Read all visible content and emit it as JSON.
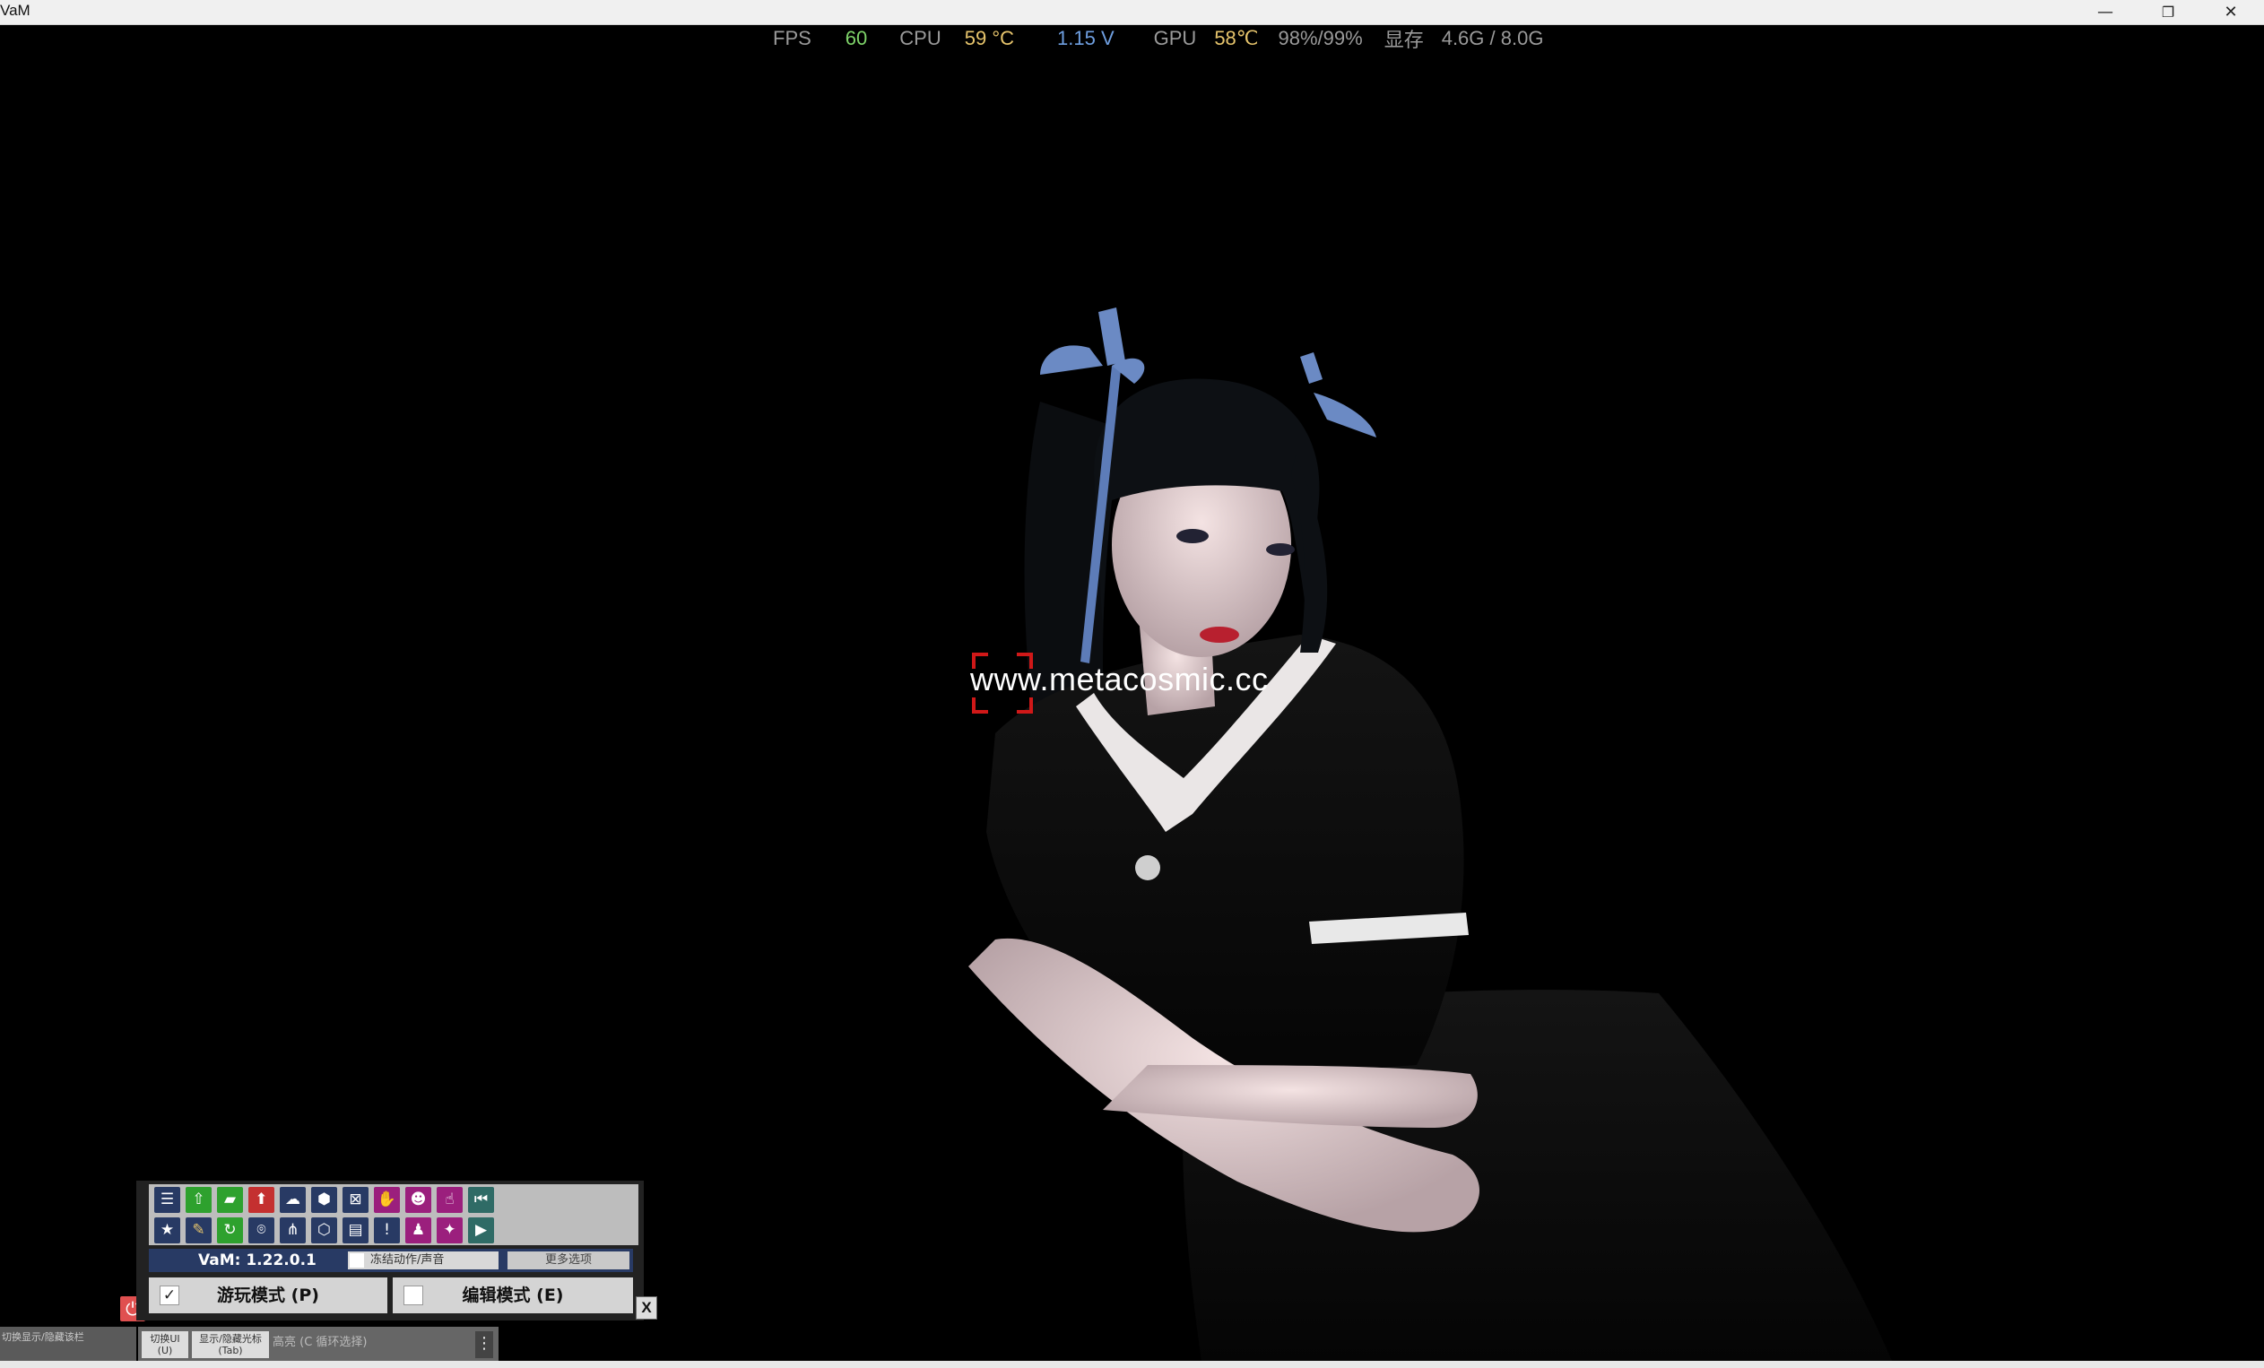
{
  "window": {
    "title": "VaM",
    "controls": {
      "minimize": "—",
      "restore": "❐",
      "close": "✕"
    }
  },
  "overlay": {
    "fps_label": "FPS",
    "fps_value": "60",
    "cpu_label": "CPU",
    "cpu_temp": "59 °C",
    "cpu_voltage": "1.15 V",
    "gpu_label": "GPU",
    "gpu_temp": "58℃",
    "gpu_usage": "98%/99%",
    "vram_label": "显存",
    "vram_value": "4.6G / 8.0G",
    "colors": {
      "label": "#9a9a9a",
      "fps": "#7fd46a",
      "temp": "#e6c46c",
      "voltage": "#6f9fe0"
    }
  },
  "scene": {
    "watermark": "www.metacosmic.cc",
    "crosshair_color": "#d01818"
  },
  "panel": {
    "icons_row1": [
      "menu-icon",
      "load-scene-icon",
      "open-folder-icon",
      "save-icon",
      "cloud-icon",
      "package-icon",
      "inbox-icon",
      "hand-icon",
      "person-settings-icon",
      "pointer-hand-icon",
      "rewind-start-icon"
    ],
    "icons_row2": [
      "star-icon",
      "edit-folder-icon",
      "folder-refresh-icon",
      "camera-icon",
      "nodes-icon",
      "box-icon",
      "document-icon",
      "warning-icon",
      "person-icon",
      "wrench-icon",
      "play-icon"
    ],
    "version": "VaM: 1.22.0.1",
    "freeze_label": "冻结动作/声音",
    "more_options": "更多选项",
    "play_mode": "游玩模式 (P)",
    "play_checked": "✓",
    "edit_mode": "编辑模式 (E)",
    "close": "X",
    "power": "⏻"
  },
  "toolbar": {
    "left_label": "切换显示/隐藏该栏",
    "toggle_ui": "切换UI\n(U)",
    "toggle_cursor": "显示/隐藏光标\n(Tab)",
    "highlight": "高亮 (C 循环选择)",
    "menu_dots": "⋮"
  }
}
